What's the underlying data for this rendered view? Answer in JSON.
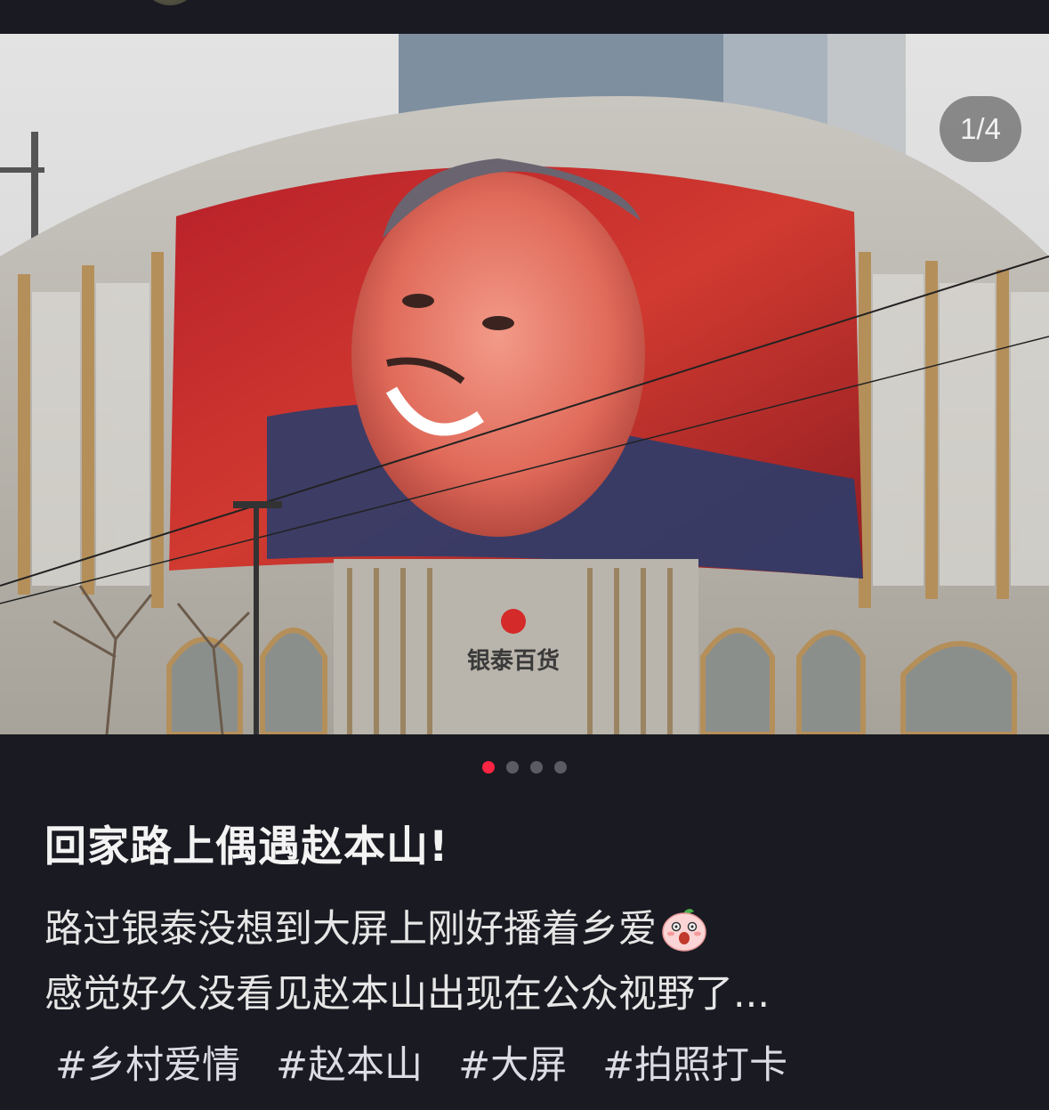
{
  "header": {
    "avatar_icon": "user-avatar"
  },
  "gallery": {
    "counter": "1/4",
    "image_count": 4,
    "active_index": 0,
    "active_dot_color": "#ff2442",
    "inactive_dot_color": "#5b5b63",
    "sign_text": "银泰百货"
  },
  "post": {
    "title": "回家路上偶遇赵本山!",
    "desc_line1": "路过银泰没想到大屏上刚好播着乡爱",
    "desc_emoji": "surprised-peach-emoji",
    "desc_line2": "感觉好久没看见赵本山出现在公众视野了...",
    "tags": [
      "#乡村爱情",
      "#赵本山",
      "#大屏",
      "#拍照打卡"
    ]
  },
  "colors": {
    "background": "#1a1a22",
    "text": "#e6e6e6",
    "accent": "#ff2442"
  }
}
